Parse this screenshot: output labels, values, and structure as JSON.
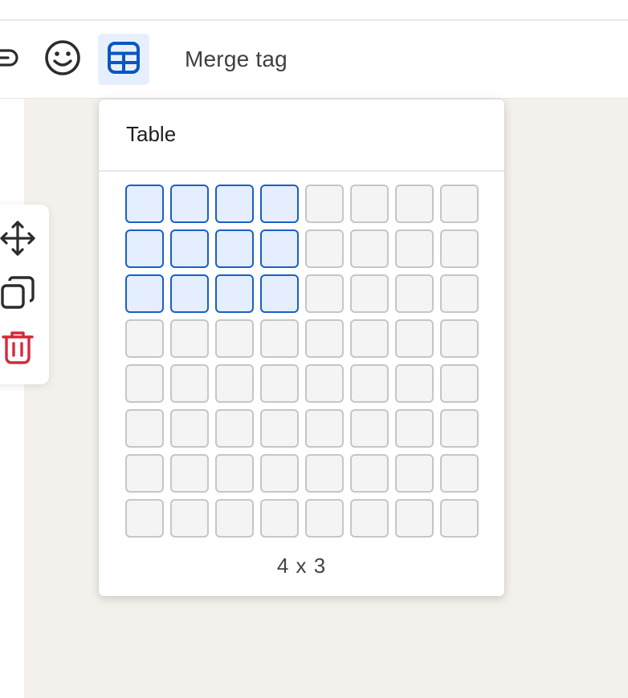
{
  "toolbar": {
    "link_icon": "link-icon",
    "emoji_icon": "emoji-icon",
    "table_icon": "table-icon",
    "merge_tag_label": "Merge tag",
    "active_color": "#0a56c2",
    "active_bg": "#e6f0fc"
  },
  "side_toolbar": {
    "icons": [
      "move-icon",
      "duplicate-icon",
      "delete-icon"
    ],
    "delete_color": "#d8283a"
  },
  "table_picker": {
    "title": "Table",
    "rows": 8,
    "columns": 8,
    "selected_columns": 4,
    "selected_rows": 3,
    "size_label": "4 x 3",
    "selected_color": "#1a5fc7"
  }
}
